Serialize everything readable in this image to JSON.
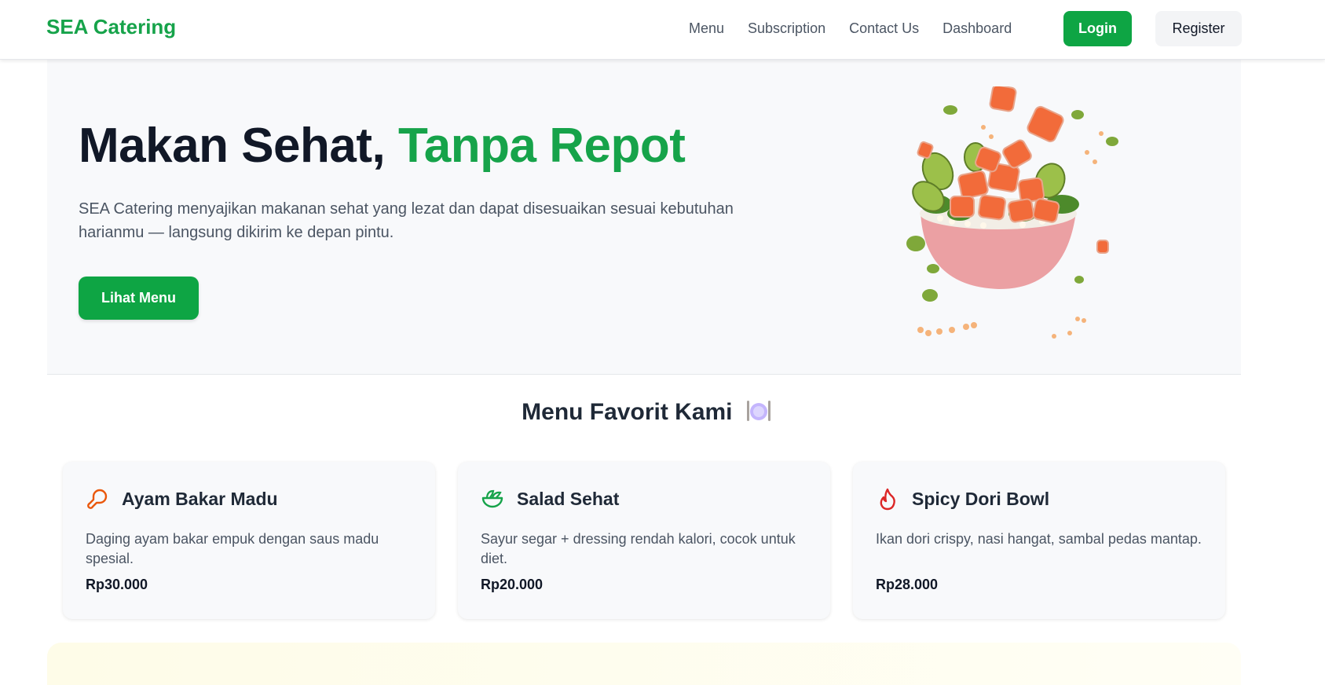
{
  "nav": {
    "brand": "SEA Catering",
    "links": [
      "Menu",
      "Subscription",
      "Contact Us",
      "Dashboard"
    ],
    "login_label": "Login",
    "register_label": "Register"
  },
  "hero": {
    "title_main": "Makan Sehat,",
    "title_accent": "Tanpa Repot",
    "description": "SEA Catering menyajikan makanan sehat yang lezat dan dapat disesuaikan sesuai kebutuhan harianmu — langsung dikirim ke depan pintu.",
    "cta_label": "Lihat Menu",
    "image_icon": "salmon-poke-bowl-image"
  },
  "menu": {
    "title": "Menu Favorit Kami",
    "title_icon": "plate-cutlery-icon",
    "items": [
      {
        "name": "Ayam Bakar Madu",
        "description": "Daging ayam bakar empuk dengan saus madu spesial.",
        "price": "Rp30.000",
        "icon": "drumstick-icon",
        "icon_color": "#ea580c"
      },
      {
        "name": "Salad Sehat",
        "description": "Sayur segar + dressing rendah kalori, cocok untuk diet.",
        "price": "Rp20.000",
        "icon": "salad-icon",
        "icon_color": "#16a34a"
      },
      {
        "name": "Spicy Dori Bowl",
        "description": "Ikan dori crispy, nasi hangat, sambal pedas mantap.",
        "price": "Rp28.000",
        "icon": "flame-icon",
        "icon_color": "#dc2626"
      }
    ]
  },
  "colors": {
    "brand_green": "#16a34a",
    "button_green": "#0ea544",
    "hero_bg": "#f8f9fb",
    "heading_dark": "#111827"
  }
}
